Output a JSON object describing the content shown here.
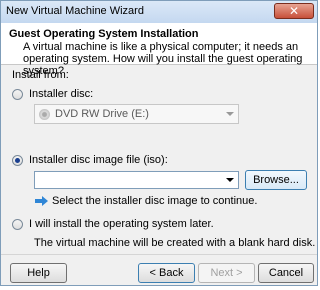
{
  "window": {
    "title": "New Virtual Machine Wizard",
    "close_glyph": "✕"
  },
  "header": {
    "title": "Guest Operating System Installation",
    "description": "A virtual machine is like a physical computer; it needs an operating system. How will you install the guest operating system?"
  },
  "install_from": {
    "label": "Install from:"
  },
  "options": {
    "disc": {
      "label": "Installer disc:",
      "selected": false
    },
    "disc_drive": {
      "value": "DVD RW Drive (E:)",
      "icon": "dvd-drive-icon"
    },
    "iso": {
      "label": "Installer disc image file (iso):",
      "selected": true
    },
    "iso_path": {
      "value": "",
      "placeholder": ""
    },
    "browse": {
      "label": "Browse..."
    },
    "iso_hint": {
      "text": "Select the installer disc image to continue.",
      "icon": "info-arrow-icon"
    },
    "later": {
      "label": "I will install the operating system later.",
      "selected": false
    },
    "later_note": {
      "text": "The virtual machine will be created with a blank hard disk."
    }
  },
  "buttons": {
    "help": "Help",
    "back": "< Back",
    "next": "Next >",
    "cancel": "Cancel"
  },
  "colors": {
    "accent": "#1a3f8f",
    "hint_arrow": "#2f86d6",
    "close": "#c7503a"
  }
}
